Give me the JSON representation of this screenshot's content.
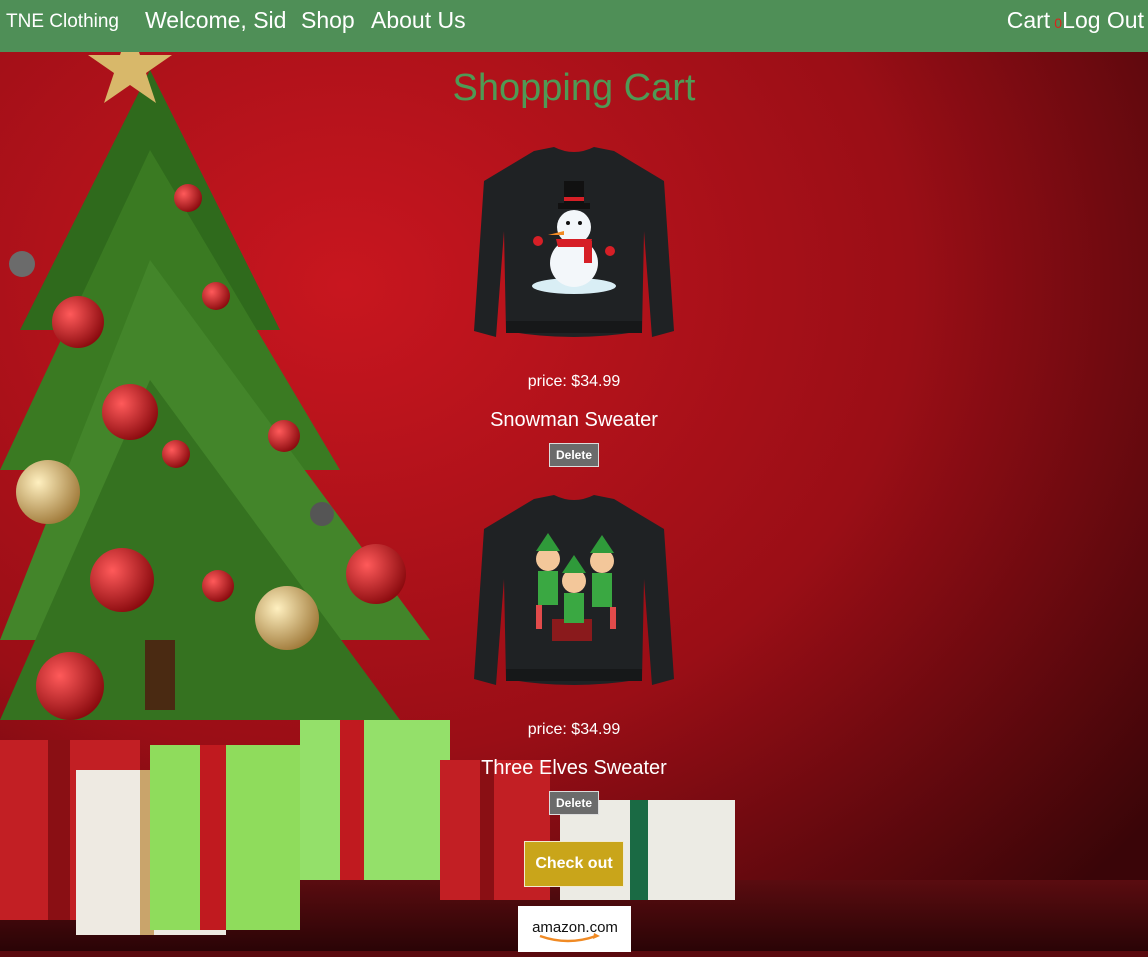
{
  "nav": {
    "brand": "TNE Clothing",
    "welcome": "Welcome, Sid",
    "shop": "Shop",
    "about": "About Us",
    "cart": "Cart",
    "cart_count": "0",
    "logout": "Log Out"
  },
  "page": {
    "title": "Shopping Cart"
  },
  "cart": {
    "items": [
      {
        "price": "price: $34.99",
        "name": "Snowman Sweater",
        "delete_label": "Delete"
      },
      {
        "price": "price: $34.99",
        "name": "Three Elves Sweater",
        "delete_label": "Delete"
      }
    ],
    "checkout_label": "Check out"
  },
  "payment": {
    "amazon_label": "amazon.com"
  },
  "colors": {
    "navbar": "#4f8f57",
    "title": "#4f9a55",
    "cart_count": "#d9241c",
    "checkout": "#c9a51a",
    "delete": "#6b6b6b"
  }
}
